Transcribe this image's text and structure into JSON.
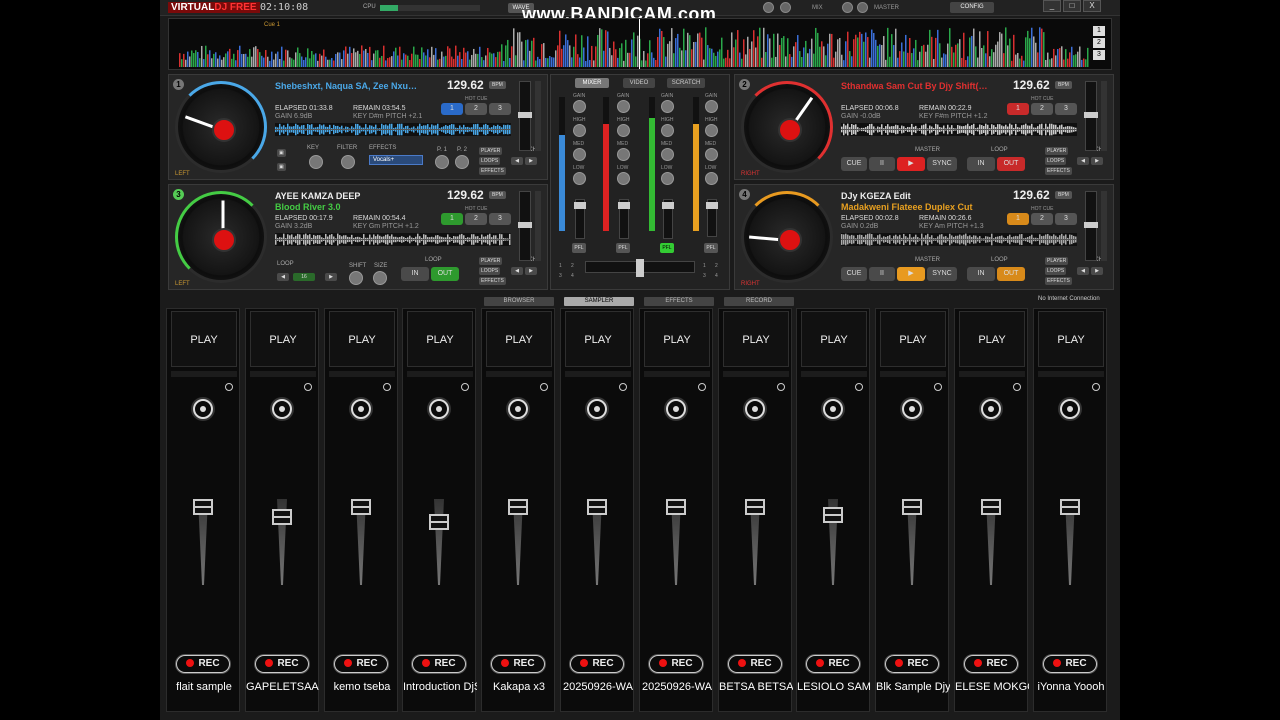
{
  "titlebar": {
    "logo_a": "VIRTUAL",
    "logo_b": "DJ FREE",
    "clock": "02:10:08",
    "cpu": "CPU",
    "wave": "WAVE",
    "mix": "MIX",
    "master": "MASTER",
    "config": "CONFIG",
    "watermark": "www.BANDICAM.com",
    "win_min": "_",
    "win_max": "□",
    "win_close": "X"
  },
  "overview": {
    "cue": "Cue 1",
    "nums": [
      "1",
      "2",
      "3"
    ]
  },
  "decks": [
    {
      "num": "1",
      "side": "LEFT",
      "title": "Shebeshxt, Naqua SA, Zee Nxu…",
      "subtitle": "",
      "bpm": "129.62",
      "bpm_tag": "BPM",
      "elapsed": "ELAPSED 01:33.8",
      "remain": "REMAIN 03:54.5",
      "gain": "GAIN 6.9dB",
      "key": "KEY D#m  PITCH +2.1",
      "hot_cue": "HOT CUE",
      "hot": [
        "1",
        "2",
        "3"
      ],
      "accent": "#4aa8e8"
    },
    {
      "num": "2",
      "side": "RIGHT",
      "title": "Sthandwa Sam Cut By Djy Shift(…",
      "subtitle": "",
      "bpm": "129.62",
      "bpm_tag": "BPM",
      "elapsed": "ELAPSED 00:06.8",
      "remain": "REMAIN 00:22.9",
      "gain": "GAIN -0.0dB",
      "key": "KEY F#m  PITCH +1.2",
      "hot_cue": "HOT CUE",
      "hot": [
        "1",
        "2",
        "3"
      ],
      "accent": "#e03030"
    },
    {
      "num": "3",
      "side": "LEFT",
      "title": "AYEE KAMZA DEEP",
      "subtitle": "Blood River 3.0",
      "bpm": "129.62",
      "bpm_tag": "BPM",
      "elapsed": "ELAPSED 00:17.9",
      "remain": "REMAIN 00:54.4",
      "gain": "GAIN 3.2dB",
      "key": "KEY Gm  PITCH +1.2",
      "hot_cue": "HOT CUE",
      "hot": [
        "1",
        "2",
        "3"
      ],
      "accent": "#44cc44"
    },
    {
      "num": "4",
      "side": "RIGHT",
      "title": "DJy KGEZA Edit",
      "subtitle": "Madakweni Flateee Duplex Cut",
      "bpm": "129.62",
      "bpm_tag": "BPM",
      "elapsed": "ELAPSED 00:02.8",
      "remain": "REMAIN 00:26.6",
      "gain": "GAIN 0.2dB",
      "key": "KEY Am  PITCH +1.3",
      "hot_cue": "HOT CUE",
      "hot": [
        "1",
        "2",
        "3"
      ],
      "accent": "#e89a20"
    }
  ],
  "deck_controls": {
    "key": "KEY",
    "filter": "FILTER",
    "effects": "EFFECTS",
    "fx_select": "Vocals+",
    "p1": "P. 1",
    "p2": "P. 2",
    "player": "PLAYER",
    "loops": "LOOPS",
    "effects_btn": "EFFECTS",
    "pitch": "PITCH",
    "loop": "LOOP",
    "shift": "SHIFT",
    "size": "SIZE",
    "loop_size": "16",
    "in": "IN",
    "out": "OUT",
    "cue": "CUE",
    "pause": "II",
    "play": "▶",
    "sync": "SYNC",
    "master": "MASTER"
  },
  "mixer": {
    "tabs": [
      "MIXER",
      "VIDEO",
      "SCRATCH"
    ],
    "gain": "GAIN",
    "high": "HIGH",
    "med": "MED",
    "low": "LOW",
    "pfl": "PFL",
    "x_left": [
      "1",
      "3"
    ],
    "x_right": [
      "2",
      "4"
    ]
  },
  "bottom_tabs": [
    "BROWSER",
    "SAMPLER",
    "EFFECTS",
    "RECORD"
  ],
  "status": "No Internet Connection",
  "sampler": {
    "play": "PLAY",
    "rec": "REC",
    "slots": [
      {
        "name": "flait sample",
        "level": 1.0
      },
      {
        "name": "GAPELETSAA VOCAL",
        "level": 0.9
      },
      {
        "name": "kemo tseba",
        "level": 1.0
      },
      {
        "name": "Introduction DjStarnza",
        "level": 0.85
      },
      {
        "name": "Kakapa x3",
        "level": 1.0
      },
      {
        "name": "20250926-WA",
        "level": 1.0
      },
      {
        "name": "20250926-WA",
        "level": 1.0
      },
      {
        "name": "BETSA BETSA",
        "level": 1.0
      },
      {
        "name": "LESIOLO SAMPLE BY",
        "level": 0.92
      },
      {
        "name": "Blk Sample Djy Shift",
        "level": 1.0
      },
      {
        "name": "ELESE MOKGOTSI",
        "level": 1.0
      },
      {
        "name": "iYonna Yoooh",
        "level": 1.0
      }
    ]
  }
}
